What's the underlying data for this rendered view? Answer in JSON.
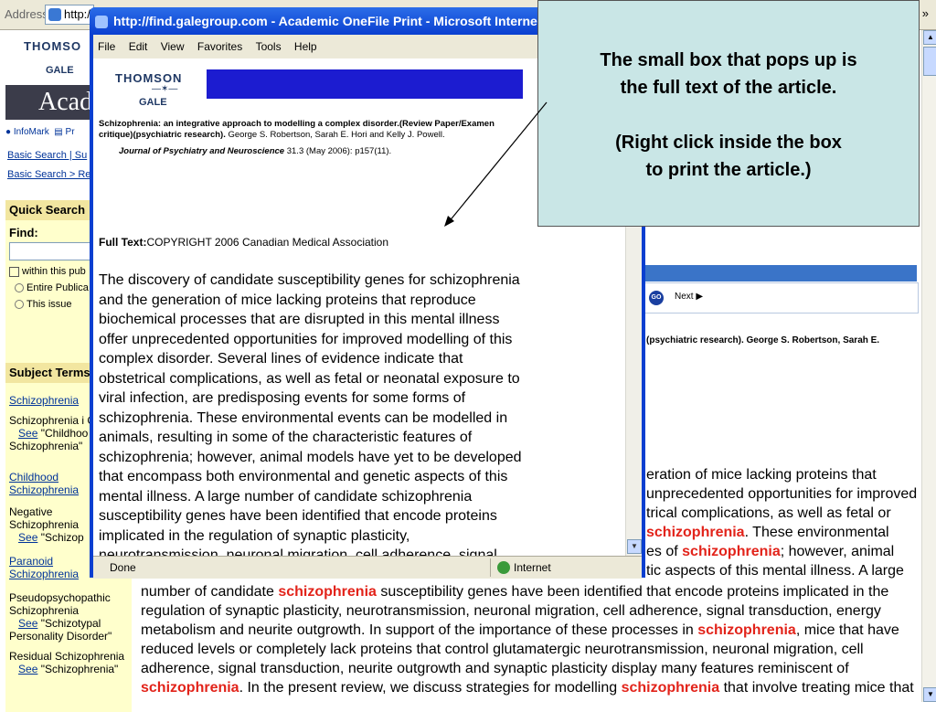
{
  "browser": {
    "address_label": "Address",
    "url_partial": "http:/",
    "toolbar_chevron": "»"
  },
  "left": {
    "logo_line1": "THOMSO",
    "logo_line2": "GALE",
    "banner": "Acade",
    "nav_infomark": "InfoMark",
    "nav_print": "Pr",
    "crumb1": "Basic Search | Su",
    "crumb2": "Basic Search > Res",
    "quick_search": "Quick Search",
    "find": "Find:",
    "within": "within this pub",
    "entire": "Entire Publica",
    "this_issue": "This issue",
    "subject_terms": "Subject Terms",
    "terms": [
      {
        "text": "Schizophrenia",
        "link": true
      },
      {
        "text": "Schizophrenia i Children",
        "link": false,
        "see": "See",
        "see_text": "\"Childhoo Schizophrenia\""
      },
      {
        "text": "Childhood Schizophrenia",
        "link": true
      },
      {
        "text": "Negative Schizophrenia",
        "link": false,
        "see": "See",
        "see_text": "\"Schizop"
      },
      {
        "text": "Paranoid Schizophrenia",
        "link": true
      },
      {
        "text": "Pseudopsychopathic Schizophrenia",
        "link": false,
        "see": "See",
        "see_text": "\"Schizotypal Personality Disorder\""
      },
      {
        "text": "Residual Schizophrenia",
        "link": false,
        "see": "See",
        "see_text": "\"Schizophrenia\""
      }
    ]
  },
  "main": {
    "next": "Next",
    "go": "GO",
    "cite_right": "(psychiatric research). George S. Robertson, Sarah E.",
    "right_lines": [
      {
        "pre": "eration of mice lacking proteins that",
        "hl": "",
        "post": ""
      },
      {
        "pre": "unprecedented opportunities for improved",
        "hl": "",
        "post": ""
      },
      {
        "pre": "trical complications, as well as fetal or",
        "hl": "",
        "post": ""
      },
      {
        "pre": "",
        "hl": "schizophrenia",
        "post": ". These environmental"
      },
      {
        "pre": "es of ",
        "hl": "schizophrenia",
        "post": "; however, animal"
      },
      {
        "pre": "tic aspects of this mental illness. A large",
        "hl": "",
        "post": ""
      }
    ],
    "bottom_lines": [
      {
        "a": "number of candidate ",
        "h1": "schizophrenia",
        "b": " susceptibility genes have been identified that encode proteins implicated in the",
        "h2": "",
        "c": ""
      },
      {
        "a": "regulation of synaptic plasticity, neurotransmission, neuronal migration, cell adherence, signal transduction, energy",
        "h1": "",
        "b": "",
        "h2": "",
        "c": ""
      },
      {
        "a": "metabolism and neurite outgrowth. In support of the importance of these processes in ",
        "h1": "schizophrenia",
        "b": ", mice that have",
        "h2": "",
        "c": ""
      },
      {
        "a": "reduced levels or completely lack proteins that control glutamatergic neurotransmission, neuronal migration, cell",
        "h1": "",
        "b": "",
        "h2": "",
        "c": ""
      },
      {
        "a": "adherence, signal transduction, neurite outgrowth and synaptic plasticity display many features reminiscent of",
        "h1": "",
        "b": "",
        "h2": "",
        "c": ""
      },
      {
        "a": "",
        "h1": "schizophrenia",
        "b": ". In the present review, we discuss strategies for modelling ",
        "h2": "schizophrenia",
        "c": " that involve treating mice that"
      }
    ]
  },
  "popup": {
    "title": "http://find.galegroup.com - Academic OneFile Print - Microsoft Internet",
    "menu": [
      "File",
      "Edit",
      "View",
      "Favorites",
      "Tools",
      "Help"
    ],
    "logo_top": "THOMSON",
    "logo_bottom": "GALE",
    "cite_title": "Schizophrenia: an integrative approach to modelling a complex disorder.(Review Paper/Examen critique)(psychiatric research).",
    "cite_authors": " George S. Robertson, Sarah E. Hori and Kelly J. Powell.",
    "journal": "Journal of Psychiatry and Neuroscience",
    "journal_info": " 31.3 (May 2006): p157(11).",
    "full_text_label": "Full Text:",
    "full_text_copy": "COPYRIGHT 2006 Canadian Medical Association",
    "body_lines": [
      "The discovery of candidate susceptibility genes for schizophrenia",
      "and the generation of mice lacking proteins that reproduce",
      "biochemical processes that are disrupted in this mental illness",
      "offer unprecedented opportunities for improved modelling of this",
      "complex disorder. Several lines of evidence indicate that",
      "obstetrical complications, as well as fetal or neonatal exposure to",
      "viral infection, are predisposing events for some forms of",
      "schizophrenia. These environmental events can be modelled in",
      "animals, resulting in some of the characteristic features of",
      "schizophrenia; however, animal models have yet to be developed",
      "that encompass both environmental and genetic aspects of this",
      "mental illness. A large number of candidate schizophrenia",
      "susceptibility genes have been identified that encode proteins",
      "implicated in the regulation of synaptic plasticity,",
      "neurotransmission, neuronal migration, cell adherence, signal"
    ],
    "status_done": "Done",
    "status_zone": "Internet"
  },
  "note": {
    "line1": "The small box that pops up is",
    "line2": "the full text of the article.",
    "line3": "(Right click inside the box",
    "line4": "to print the article.)"
  },
  "colors": {
    "highlight": "#e2231a",
    "popup_frame": "#0a3fd0",
    "note_bg": "#c9e6e6"
  }
}
